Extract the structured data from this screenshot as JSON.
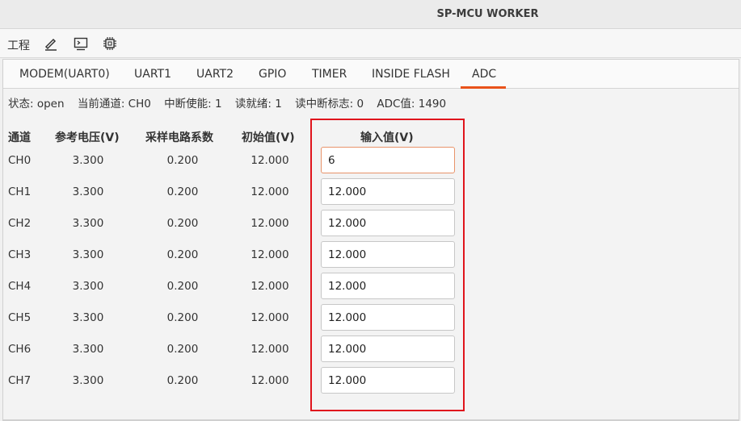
{
  "window": {
    "title": "SP-MCU WORKER"
  },
  "toolbar": {
    "menu_label": "工程",
    "buttons": [
      {
        "icon": "pencil-icon"
      },
      {
        "icon": "terminal-icon"
      },
      {
        "icon": "chip-icon"
      }
    ]
  },
  "tabs": [
    {
      "label": "MODEM(UART0)"
    },
    {
      "label": "UART1"
    },
    {
      "label": "UART2"
    },
    {
      "label": "GPIO"
    },
    {
      "label": "TIMER"
    },
    {
      "label": "INSIDE FLASH"
    },
    {
      "label": "ADC",
      "active": true
    }
  ],
  "status": {
    "state": "状态: open",
    "channel": "当前通道: CH0",
    "interrupt": "中断使能: 1",
    "ready": "读就绪: 1",
    "int_flag": "读中断标志: 0",
    "adc_value": "ADC值: 1490"
  },
  "table": {
    "headers": {
      "channel": "通道",
      "ref_voltage": "参考电压(V)",
      "coefficient": "采样电路系数",
      "initial": "初始值(V)",
      "input": "输入值(V)"
    },
    "rows": [
      {
        "channel": "CH0",
        "ref_voltage": "3.300",
        "coefficient": "0.200",
        "initial": "12.000",
        "input": "6"
      },
      {
        "channel": "CH1",
        "ref_voltage": "3.300",
        "coefficient": "0.200",
        "initial": "12.000",
        "input": "12.000"
      },
      {
        "channel": "CH2",
        "ref_voltage": "3.300",
        "coefficient": "0.200",
        "initial": "12.000",
        "input": "12.000"
      },
      {
        "channel": "CH3",
        "ref_voltage": "3.300",
        "coefficient": "0.200",
        "initial": "12.000",
        "input": "12.000"
      },
      {
        "channel": "CH4",
        "ref_voltage": "3.300",
        "coefficient": "0.200",
        "initial": "12.000",
        "input": "12.000"
      },
      {
        "channel": "CH5",
        "ref_voltage": "3.300",
        "coefficient": "0.200",
        "initial": "12.000",
        "input": "12.000"
      },
      {
        "channel": "CH6",
        "ref_voltage": "3.300",
        "coefficient": "0.200",
        "initial": "12.000",
        "input": "12.000"
      },
      {
        "channel": "CH7",
        "ref_voltage": "3.300",
        "coefficient": "0.200",
        "initial": "12.000",
        "input": "12.000"
      }
    ]
  },
  "colors": {
    "accent": "#e9521a",
    "highlight_border": "#e0141c",
    "focus_border": "#e8936a"
  }
}
